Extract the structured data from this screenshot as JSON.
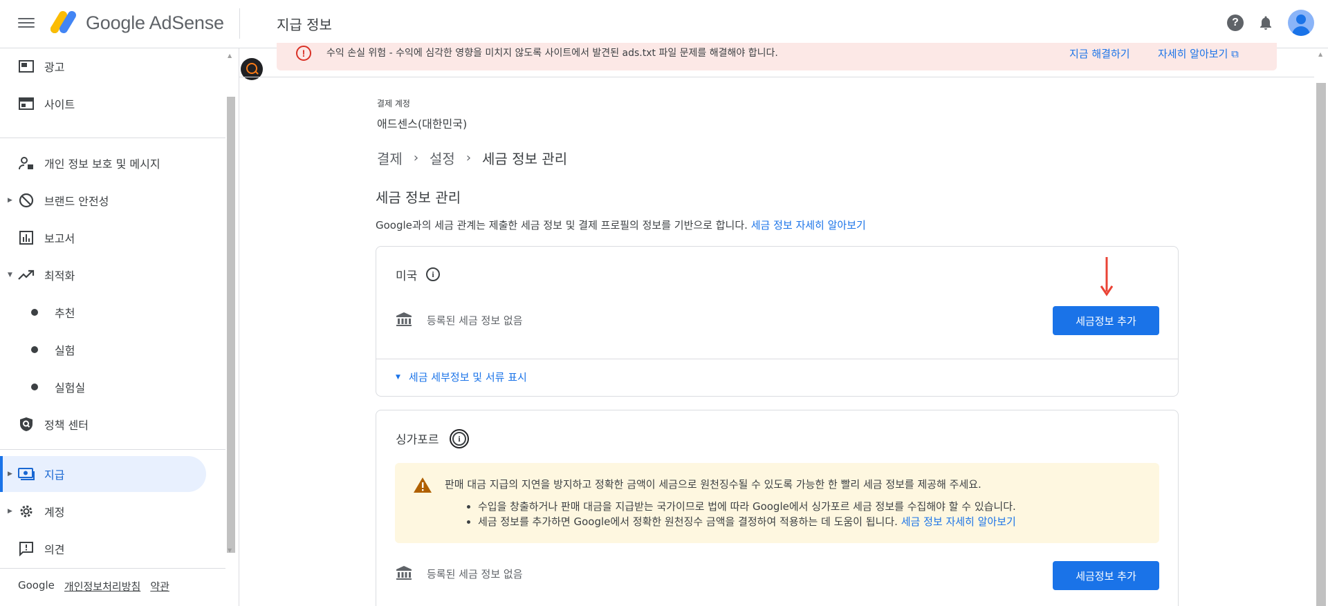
{
  "header": {
    "brand": "Google AdSense",
    "page_title": "지급 정보"
  },
  "sidebar": {
    "items": [
      {
        "label": "광고"
      },
      {
        "label": "사이트"
      },
      {
        "label": "개인 정보 보호 및 메시지"
      },
      {
        "label": "브랜드 안전성"
      },
      {
        "label": "보고서"
      },
      {
        "label": "최적화"
      },
      {
        "label": "추천"
      },
      {
        "label": "실험"
      },
      {
        "label": "실험실"
      },
      {
        "label": "정책 센터"
      },
      {
        "label": "지급"
      },
      {
        "label": "계정"
      },
      {
        "label": "의견"
      }
    ],
    "footer": {
      "google": "Google",
      "privacy": "개인정보처리방침",
      "terms": "약관"
    }
  },
  "banner": {
    "message": "수익 손실 위험 - 수익에 심각한 영향을 미치지 않도록 사이트에서 발견된 ads.txt 파일 문제를 해결해야 합니다.",
    "fix_label": "지금 해결하기",
    "more_label": "자세히 알아보기"
  },
  "main": {
    "account_label": "결제 계정",
    "account_value": "애드센스(대한민국)",
    "breadcrumb": [
      "결제",
      "설정",
      "세금 정보 관리"
    ],
    "section_title": "세금 정보 관리",
    "description": "Google과의 세금 관계는 제출한 세금 정보 및 결제 프로필의 정보를 기반으로 합니다.",
    "description_link": "세금 정보 자세히 알아보기",
    "us_card": {
      "country": "미국",
      "no_info": "등록된 세금 정보 없음",
      "button": "세금정보 추가",
      "expand_label": "세금 세부정보 및 서류 표시"
    },
    "sg_card": {
      "country": "싱가포르",
      "warning_head": "판매 대금 지급의 지연을 방지하고 정확한 금액이 세금으로 원천징수될 수 있도록 가능한 한 빨리 세금 정보를 제공해 주세요.",
      "bullet1": "수입을 창출하거나 판매 대금을 지급받는 국가이므로 법에 따라 Google에서 싱가포르 세금 정보를 수집해야 할 수 있습니다.",
      "bullet2": "세금 정보를 추가하면 Google에서 정확한 원천징수 금액을 결정하여 적용하는 데 도움이 됩니다.",
      "bullet2_link": "세금 정보 자세히 알아보기",
      "no_info": "등록된 세금 정보 없음",
      "button": "세금정보 추가"
    }
  },
  "colors": {
    "accent": "#1a73e8",
    "error": "#d93025",
    "warning": "#b06000",
    "annotation_arrow": "#ea4335"
  }
}
